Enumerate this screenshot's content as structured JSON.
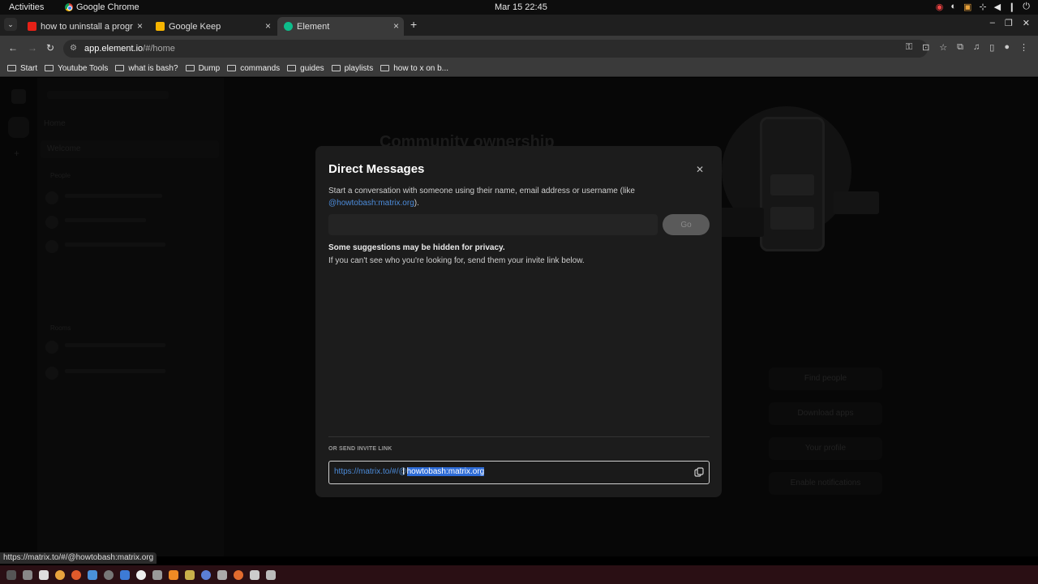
{
  "topbar": {
    "activities": "Activities",
    "app_name": "Google Chrome",
    "clock": "Mar 15  22:45"
  },
  "tabs": [
    {
      "title": "how to uninstall a progr",
      "favicon_color": "#e62117",
      "active": false
    },
    {
      "title": "Google Keep",
      "favicon_color": "#f5b400",
      "active": false
    },
    {
      "title": "Element",
      "favicon_color": "#0dbd8b",
      "active": true
    }
  ],
  "address_bar": {
    "host": "app.element.io",
    "path": "/#/home"
  },
  "bookmarks": [
    {
      "label": "Start"
    },
    {
      "label": "Youtube Tools"
    },
    {
      "label": "what is bash?"
    },
    {
      "label": "Dump"
    },
    {
      "label": "commands"
    },
    {
      "label": "guides"
    },
    {
      "label": "playlists"
    },
    {
      "label": "how to x on b..."
    }
  ],
  "background": {
    "room_header": "Home",
    "welcome": "Welcome",
    "people_header": "People",
    "rooms_header": "Rooms",
    "hero_title": "Community ownership",
    "buttons": [
      "Find people",
      "Download apps",
      "Your profile",
      "Enable notifications"
    ]
  },
  "dialog": {
    "title": "Direct Messages",
    "description_prefix": "Start a conversation with someone using their name, email address or username (like ",
    "description_link": "@howtobash:matrix.org",
    "description_suffix": ").",
    "search_value": "",
    "go_label": "Go",
    "privacy_title": "Some suggestions may be hidden for privacy.",
    "privacy_desc": "If you can't see who you're looking for, send them your invite link below.",
    "invite_label": "OR SEND INVITE LINK",
    "invite_link_prefix": "https://matrix.to/#/@",
    "invite_link_selected": "howtobash:matrix.org"
  },
  "status_url": "https://matrix.to/#/@howtobash:matrix.org",
  "colors": {
    "accent_link": "#4c8bd9",
    "selection": "#2d6bd6",
    "dock_bg": "#2a0f14"
  }
}
